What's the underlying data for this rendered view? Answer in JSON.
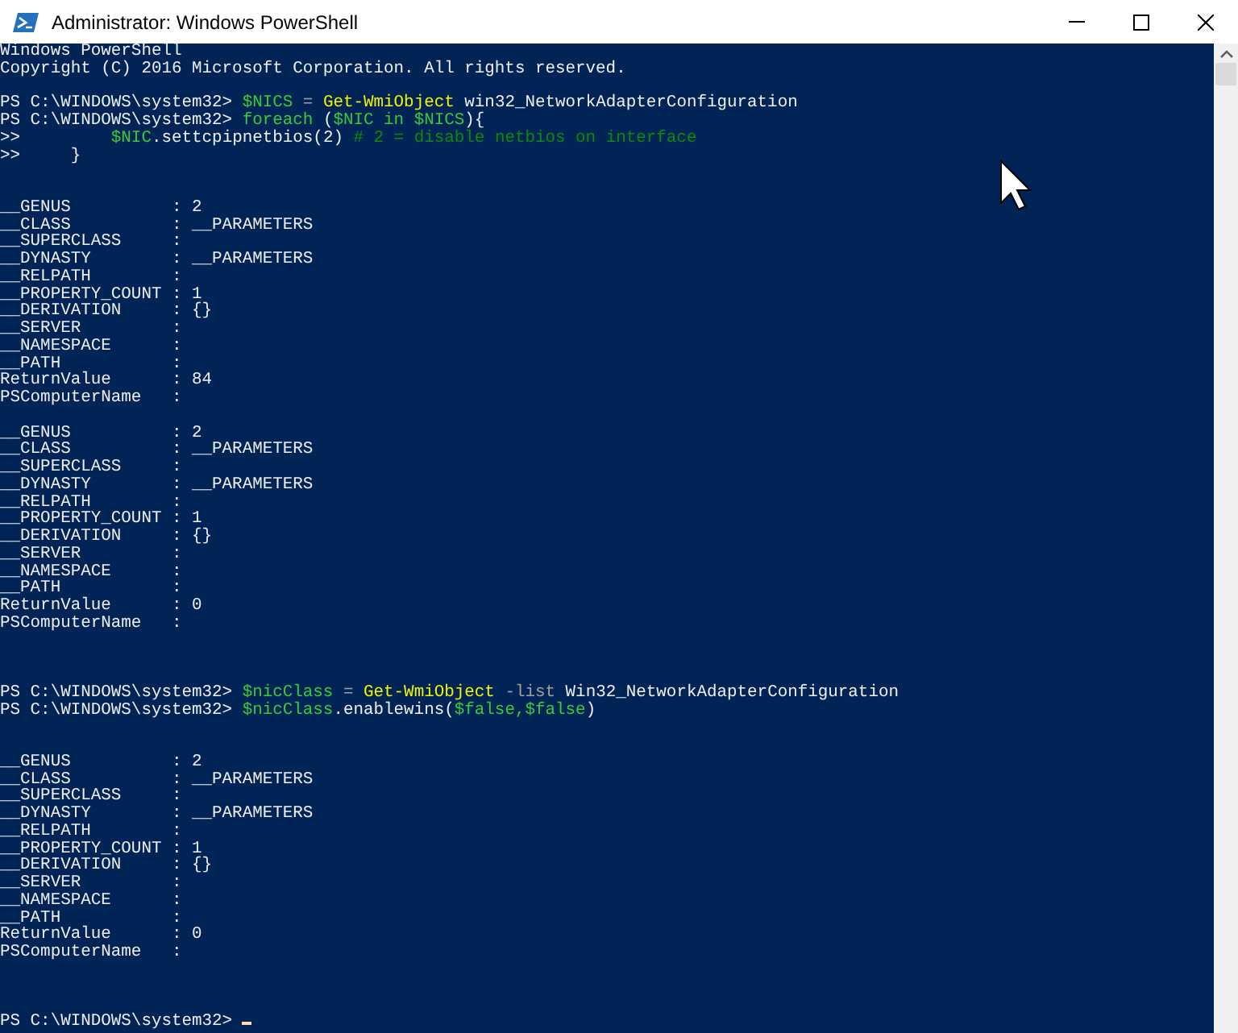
{
  "window": {
    "title": "Administrator: Windows PowerShell"
  },
  "console": {
    "lines": [
      {
        "kind": "text",
        "spans": [
          {
            "kind": "plain",
            "text": "Windows PowerShell"
          }
        ]
      },
      {
        "kind": "text",
        "spans": [
          {
            "kind": "plain",
            "text": "Copyright (C) 2016 Microsoft Corporation. All rights reserved."
          }
        ]
      },
      {
        "kind": "blank"
      },
      {
        "kind": "text",
        "spans": [
          {
            "kind": "plain",
            "text": "PS C:\\WINDOWS\\system32> "
          },
          {
            "kind": "variable",
            "text": "$NICS"
          },
          {
            "kind": "operator",
            "text": " = "
          },
          {
            "kind": "command",
            "text": "Get-WmiObject"
          },
          {
            "kind": "plain",
            "text": " win32_NetworkAdapterConfiguration"
          }
        ]
      },
      {
        "kind": "text",
        "spans": [
          {
            "kind": "plain",
            "text": "PS C:\\WINDOWS\\system32> "
          },
          {
            "kind": "variable",
            "text": "foreach"
          },
          {
            "kind": "plain",
            "text": " ("
          },
          {
            "kind": "variable",
            "text": "$NIC in $NICS"
          },
          {
            "kind": "plain",
            "text": "){"
          }
        ]
      },
      {
        "kind": "text",
        "spans": [
          {
            "kind": "plain",
            "text": ">>         "
          },
          {
            "kind": "variable",
            "text": "$NIC"
          },
          {
            "kind": "plain",
            "text": ".settcpipnetbios(2) "
          },
          {
            "kind": "comment",
            "text": "# 2 = disable netbios on interface"
          }
        ]
      },
      {
        "kind": "text",
        "spans": [
          {
            "kind": "plain",
            "text": ">>     }"
          }
        ]
      },
      {
        "kind": "blank"
      },
      {
        "kind": "blank"
      },
      {
        "kind": "text",
        "spans": [
          {
            "kind": "plain",
            "text": "__GENUS          : 2"
          }
        ]
      },
      {
        "kind": "text",
        "spans": [
          {
            "kind": "plain",
            "text": "__CLASS          : __PARAMETERS"
          }
        ]
      },
      {
        "kind": "text",
        "spans": [
          {
            "kind": "plain",
            "text": "__SUPERCLASS     :"
          }
        ]
      },
      {
        "kind": "text",
        "spans": [
          {
            "kind": "plain",
            "text": "__DYNASTY        : __PARAMETERS"
          }
        ]
      },
      {
        "kind": "text",
        "spans": [
          {
            "kind": "plain",
            "text": "__RELPATH        :"
          }
        ]
      },
      {
        "kind": "text",
        "spans": [
          {
            "kind": "plain",
            "text": "__PROPERTY_COUNT : 1"
          }
        ]
      },
      {
        "kind": "text",
        "spans": [
          {
            "kind": "plain",
            "text": "__DERIVATION     : {}"
          }
        ]
      },
      {
        "kind": "text",
        "spans": [
          {
            "kind": "plain",
            "text": "__SERVER         :"
          }
        ]
      },
      {
        "kind": "text",
        "spans": [
          {
            "kind": "plain",
            "text": "__NAMESPACE      :"
          }
        ]
      },
      {
        "kind": "text",
        "spans": [
          {
            "kind": "plain",
            "text": "__PATH           :"
          }
        ]
      },
      {
        "kind": "text",
        "spans": [
          {
            "kind": "plain",
            "text": "ReturnValue      : 84"
          }
        ]
      },
      {
        "kind": "text",
        "spans": [
          {
            "kind": "plain",
            "text": "PSComputerName   :"
          }
        ]
      },
      {
        "kind": "blank"
      },
      {
        "kind": "text",
        "spans": [
          {
            "kind": "plain",
            "text": "__GENUS          : 2"
          }
        ]
      },
      {
        "kind": "text",
        "spans": [
          {
            "kind": "plain",
            "text": "__CLASS          : __PARAMETERS"
          }
        ]
      },
      {
        "kind": "text",
        "spans": [
          {
            "kind": "plain",
            "text": "__SUPERCLASS     :"
          }
        ]
      },
      {
        "kind": "text",
        "spans": [
          {
            "kind": "plain",
            "text": "__DYNASTY        : __PARAMETERS"
          }
        ]
      },
      {
        "kind": "text",
        "spans": [
          {
            "kind": "plain",
            "text": "__RELPATH        :"
          }
        ]
      },
      {
        "kind": "text",
        "spans": [
          {
            "kind": "plain",
            "text": "__PROPERTY_COUNT : 1"
          }
        ]
      },
      {
        "kind": "text",
        "spans": [
          {
            "kind": "plain",
            "text": "__DERIVATION     : {}"
          }
        ]
      },
      {
        "kind": "text",
        "spans": [
          {
            "kind": "plain",
            "text": "__SERVER         :"
          }
        ]
      },
      {
        "kind": "text",
        "spans": [
          {
            "kind": "plain",
            "text": "__NAMESPACE      :"
          }
        ]
      },
      {
        "kind": "text",
        "spans": [
          {
            "kind": "plain",
            "text": "__PATH           :"
          }
        ]
      },
      {
        "kind": "text",
        "spans": [
          {
            "kind": "plain",
            "text": "ReturnValue      : 0"
          }
        ]
      },
      {
        "kind": "text",
        "spans": [
          {
            "kind": "plain",
            "text": "PSComputerName   :"
          }
        ]
      },
      {
        "kind": "blank"
      },
      {
        "kind": "blank"
      },
      {
        "kind": "blank"
      },
      {
        "kind": "text",
        "spans": [
          {
            "kind": "plain",
            "text": "PS C:\\WINDOWS\\system32> "
          },
          {
            "kind": "variable",
            "text": "$nicClass"
          },
          {
            "kind": "operator",
            "text": " = "
          },
          {
            "kind": "command",
            "text": "Get-WmiObject"
          },
          {
            "kind": "operator",
            "text": " -list"
          },
          {
            "kind": "plain",
            "text": " Win32_NetworkAdapterConfiguration"
          }
        ]
      },
      {
        "kind": "text",
        "spans": [
          {
            "kind": "plain",
            "text": "PS C:\\WINDOWS\\system32> "
          },
          {
            "kind": "variable",
            "text": "$nicClass"
          },
          {
            "kind": "plain",
            "text": ".enablewins("
          },
          {
            "kind": "variable",
            "text": "$false,$false"
          },
          {
            "kind": "plain",
            "text": ")"
          }
        ]
      },
      {
        "kind": "blank"
      },
      {
        "kind": "blank"
      },
      {
        "kind": "text",
        "spans": [
          {
            "kind": "plain",
            "text": "__GENUS          : 2"
          }
        ]
      },
      {
        "kind": "text",
        "spans": [
          {
            "kind": "plain",
            "text": "__CLASS          : __PARAMETERS"
          }
        ]
      },
      {
        "kind": "text",
        "spans": [
          {
            "kind": "plain",
            "text": "__SUPERCLASS     :"
          }
        ]
      },
      {
        "kind": "text",
        "spans": [
          {
            "kind": "plain",
            "text": "__DYNASTY        : __PARAMETERS"
          }
        ]
      },
      {
        "kind": "text",
        "spans": [
          {
            "kind": "plain",
            "text": "__RELPATH        :"
          }
        ]
      },
      {
        "kind": "text",
        "spans": [
          {
            "kind": "plain",
            "text": "__PROPERTY_COUNT : 1"
          }
        ]
      },
      {
        "kind": "text",
        "spans": [
          {
            "kind": "plain",
            "text": "__DERIVATION     : {}"
          }
        ]
      },
      {
        "kind": "text",
        "spans": [
          {
            "kind": "plain",
            "text": "__SERVER         :"
          }
        ]
      },
      {
        "kind": "text",
        "spans": [
          {
            "kind": "plain",
            "text": "__NAMESPACE      :"
          }
        ]
      },
      {
        "kind": "text",
        "spans": [
          {
            "kind": "plain",
            "text": "__PATH           :"
          }
        ]
      },
      {
        "kind": "text",
        "spans": [
          {
            "kind": "plain",
            "text": "ReturnValue      : 0"
          }
        ]
      },
      {
        "kind": "text",
        "spans": [
          {
            "kind": "plain",
            "text": "PSComputerName   :"
          }
        ]
      },
      {
        "kind": "blank"
      },
      {
        "kind": "blank"
      },
      {
        "kind": "blank"
      },
      {
        "kind": "prompt",
        "spans": [
          {
            "kind": "plain",
            "text": "PS C:\\WINDOWS\\system32> "
          }
        ]
      }
    ]
  }
}
